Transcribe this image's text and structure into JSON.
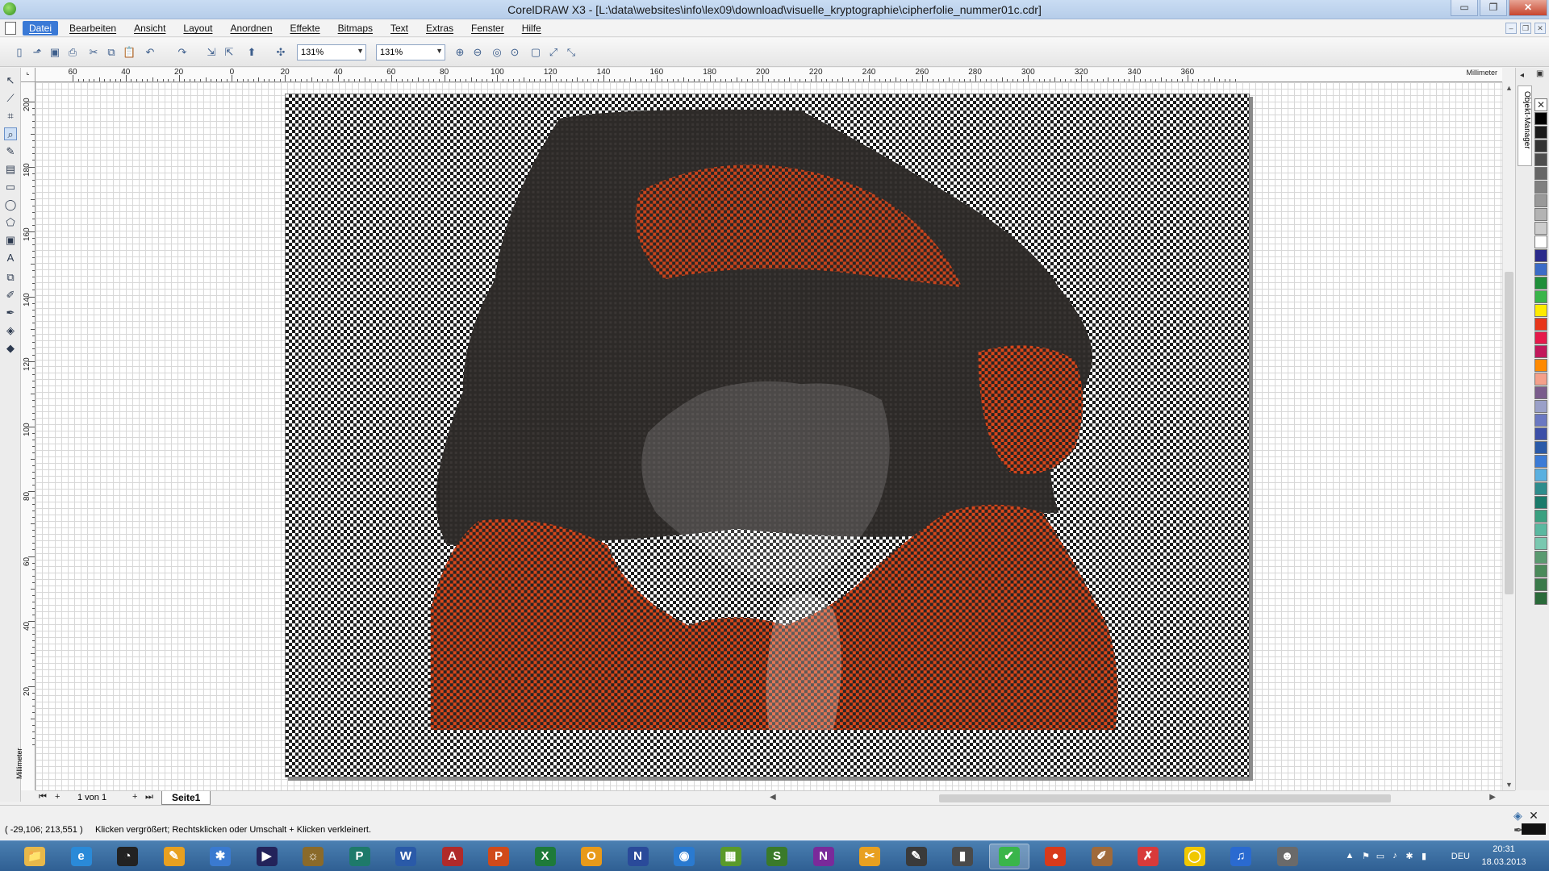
{
  "window": {
    "title": "CorelDRAW X3 - [L:\\data\\websites\\info\\lex09\\download\\visuelle_kryptographie\\cipherfolie_nummer01c.cdr]",
    "minimize": "▭",
    "restore": "❐",
    "close": "✕"
  },
  "menu": {
    "items": [
      "Datei",
      "Bearbeiten",
      "Ansicht",
      "Layout",
      "Anordnen",
      "Effekte",
      "Bitmaps",
      "Text",
      "Extras",
      "Fenster",
      "Hilfe"
    ],
    "active_index": 0
  },
  "toolbar": {
    "zoom_value_1": "131%",
    "zoom_value_2": "131%"
  },
  "ruler": {
    "unit": "Millimeter",
    "h_labels": [
      "60",
      "40",
      "20",
      "0",
      "20",
      "40",
      "60",
      "80",
      "100",
      "120",
      "140",
      "160",
      "180",
      "200",
      "220",
      "240",
      "260",
      "280",
      "300",
      "320",
      "340",
      "360"
    ],
    "v_labels": [
      "200",
      "180",
      "160",
      "140",
      "120",
      "100",
      "80",
      "60",
      "40",
      "20"
    ]
  },
  "docker": {
    "tab_label": "Objekt-Manager"
  },
  "palette": {
    "close_glyph": "✕",
    "colors": [
      "#000000",
      "#1a1a1a",
      "#333333",
      "#4d4d4d",
      "#666666",
      "#808080",
      "#999999",
      "#b3b3b3",
      "#cccccc",
      "#ffffff",
      "#2b2b8c",
      "#3b6cc7",
      "#1f8f3a",
      "#3ab54a",
      "#ffeb00",
      "#e8361a",
      "#e6194b",
      "#c2185b",
      "#ff8a00",
      "#f4a08a",
      "#7a5c8c",
      "#9aa0c8",
      "#6a78c2",
      "#3c4fa8",
      "#2a5aa8",
      "#3b7bd6",
      "#5ab0e0",
      "#2e8c8c",
      "#1a7a6a",
      "#3aa080",
      "#5ab8a0",
      "#7ac8b0",
      "#5a9a70",
      "#4a8a5a",
      "#3a7a4a",
      "#2a6a3a"
    ]
  },
  "pagebar": {
    "page_count": "1 von 1",
    "page_tab": "Seite1",
    "first": "⏮",
    "add_before": "+",
    "add_after": "+",
    "last": "⏭"
  },
  "status": {
    "coords": "( -29,106; 213,551 )",
    "hint": "Klicken vergrößert; Rechtsklicken oder Umschalt + Klicken verkleinert."
  },
  "taskbar": {
    "apps": [
      {
        "name": "file-explorer-icon",
        "glyph": "📁",
        "color": "#e8b84a"
      },
      {
        "name": "internet-explorer-icon",
        "glyph": "e",
        "color": "#2a8ad8"
      },
      {
        "name": "app-3-icon",
        "glyph": "◔",
        "color": "#222222"
      },
      {
        "name": "app-4-icon",
        "glyph": "✎",
        "color": "#e8a020"
      },
      {
        "name": "app-5-icon",
        "glyph": "✱",
        "color": "#3a7ad0"
      },
      {
        "name": "app-6-icon",
        "glyph": "▶",
        "color": "#23235a"
      },
      {
        "name": "app-7-icon",
        "glyph": "☼",
        "color": "#8a6a2a"
      },
      {
        "name": "publisher-icon",
        "glyph": "P",
        "color": "#1e7a6a"
      },
      {
        "name": "word-icon",
        "glyph": "W",
        "color": "#2a5aa8"
      },
      {
        "name": "access-icon",
        "glyph": "A",
        "color": "#b02a2a"
      },
      {
        "name": "powerpoint-icon",
        "glyph": "P",
        "color": "#d04a1a"
      },
      {
        "name": "excel-icon",
        "glyph": "X",
        "color": "#1e7a3a"
      },
      {
        "name": "outlook-icon",
        "glyph": "O",
        "color": "#e89a1a"
      },
      {
        "name": "app-14-icon",
        "glyph": "N",
        "color": "#2a4a9a"
      },
      {
        "name": "app-15-icon",
        "glyph": "◉",
        "color": "#2a7ad0"
      },
      {
        "name": "app-16-icon",
        "glyph": "▦",
        "color": "#5a9a2a"
      },
      {
        "name": "sharepoint-icon",
        "glyph": "S",
        "color": "#3a7a2a"
      },
      {
        "name": "onenote-icon",
        "glyph": "N",
        "color": "#7a2a9a"
      },
      {
        "name": "app-19-icon",
        "glyph": "✂",
        "color": "#e8a020"
      },
      {
        "name": "app-20-icon",
        "glyph": "✎",
        "color": "#3a3a3a"
      },
      {
        "name": "app-21-icon",
        "glyph": "▮",
        "color": "#4a4a4a"
      },
      {
        "name": "coreldraw-icon",
        "glyph": "✔",
        "color": "#3ab54a"
      },
      {
        "name": "app-23-icon",
        "glyph": "●",
        "color": "#d83a1a"
      },
      {
        "name": "app-24-icon",
        "glyph": "✐",
        "color": "#a06a3a"
      },
      {
        "name": "app-25-icon",
        "glyph": "✗",
        "color": "#d83a3a"
      },
      {
        "name": "app-26-icon",
        "glyph": "◯",
        "color": "#f0c800"
      },
      {
        "name": "app-27-icon",
        "glyph": "♫",
        "color": "#2a6ad0"
      },
      {
        "name": "app-28-icon",
        "glyph": "☻",
        "color": "#6a6a6a"
      }
    ],
    "active_app_index": 21,
    "language": "DEU",
    "time": "20:31",
    "date": "18.03.2013"
  }
}
